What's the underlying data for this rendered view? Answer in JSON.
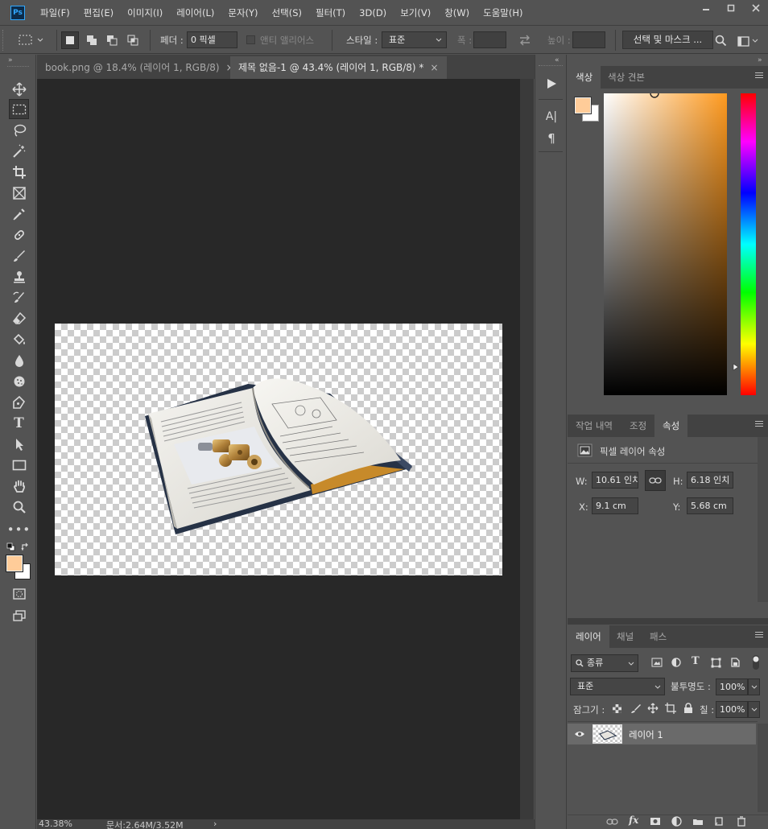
{
  "app": {
    "logo_text": "Ps"
  },
  "menu": [
    "파일(F)",
    "편집(E)",
    "이미지(I)",
    "레이어(L)",
    "문자(Y)",
    "선택(S)",
    "필터(T)",
    "3D(D)",
    "보기(V)",
    "창(W)",
    "도움말(H)"
  ],
  "options": {
    "feather_label": "페더 :",
    "feather_value": "0 픽셀",
    "antialias_label": "앤티 앨리어스",
    "style_label": "스타일 :",
    "style_value": "표준",
    "width_label": "폭 :",
    "height_label": "높이 :",
    "select_mask_label": "선택 및 마스크 ..."
  },
  "tabs": [
    {
      "title": "book.png @ 18.4% (레이어 1, RGB/8)",
      "active": false
    },
    {
      "title": "제목 없음-1 @ 43.4% (레이어 1, RGB/8) *",
      "active": true
    }
  ],
  "tab_close": "×",
  "status": {
    "zoom": "43.38%",
    "doc": "문서:2.64M/3.52M",
    "arrow": "›"
  },
  "colors": {
    "foreground": "#ffcc99",
    "background": "#ffffff",
    "picker_hue": "#ff9a1f"
  },
  "color_panel": {
    "tabs": [
      "색상",
      "색상 견본"
    ],
    "active": 0
  },
  "properties_panel": {
    "tabs": [
      "작업 내역",
      "조정",
      "속성"
    ],
    "active": 2,
    "title": "픽셀 레이어 속성",
    "w_label": "W:",
    "w_value": "10.61 인치",
    "h_label": "H:",
    "h_value": "6.18 인치",
    "x_label": "X:",
    "x_value": "9.1 cm",
    "y_label": "Y:",
    "y_value": "5.68 cm"
  },
  "layers_panel": {
    "tabs": [
      "레이어",
      "채널",
      "패스"
    ],
    "active": 0,
    "filter_label": "종류",
    "blend_mode": "표준",
    "opacity_label": "불투명도 :",
    "opacity_value": "100%",
    "lock_label": "잠그기 :",
    "fill_label": "칠 :",
    "fill_value": "100%",
    "layers": [
      {
        "name": "레이어 1",
        "visible": true
      }
    ]
  },
  "mid_text_icon": "A|",
  "mid_para_icon": "¶"
}
